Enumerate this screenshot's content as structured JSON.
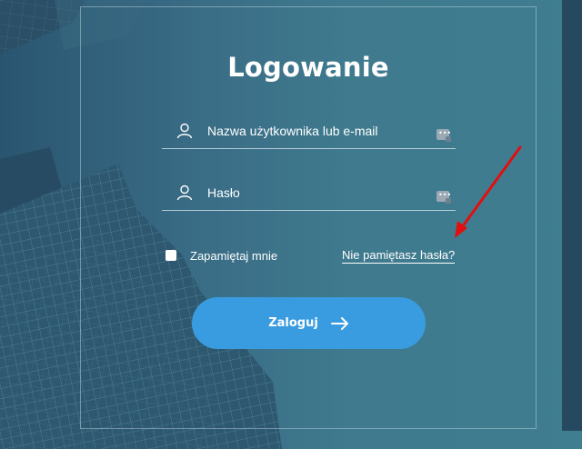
{
  "form": {
    "title": "Logowanie",
    "username": {
      "placeholder": "Nazwa użytkownika lub e-mail",
      "value": "",
      "icon": "user-icon"
    },
    "password": {
      "placeholder": "Hasło",
      "value": "",
      "icon": "user-icon"
    },
    "password_manager_icon": "password-manager-icon",
    "remember_label": "Zapamiętaj mnie",
    "remember_checked": false,
    "forgot_label": "Nie pamiętasz hasła?",
    "submit_label": "Zaloguj",
    "submit_icon": "arrow-right-icon"
  },
  "colors": {
    "button": "#3a9ce0",
    "annotation_arrow": "#e01010"
  }
}
